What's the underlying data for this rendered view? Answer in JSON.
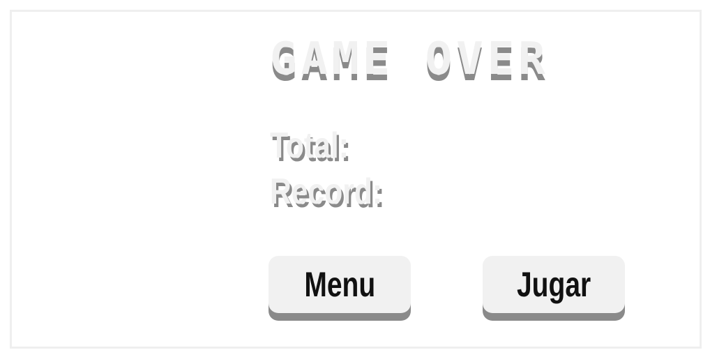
{
  "game_over": {
    "title": "GAME OVER",
    "total_label": "Total:",
    "record_label": "Record:"
  },
  "buttons": {
    "menu_label": "Menu",
    "play_label": "Jugar"
  },
  "colors": {
    "text_light": "#f1f1f1",
    "shadow": "#8a8a8a",
    "button_text": "#111111",
    "frame_border": "#efefef"
  }
}
